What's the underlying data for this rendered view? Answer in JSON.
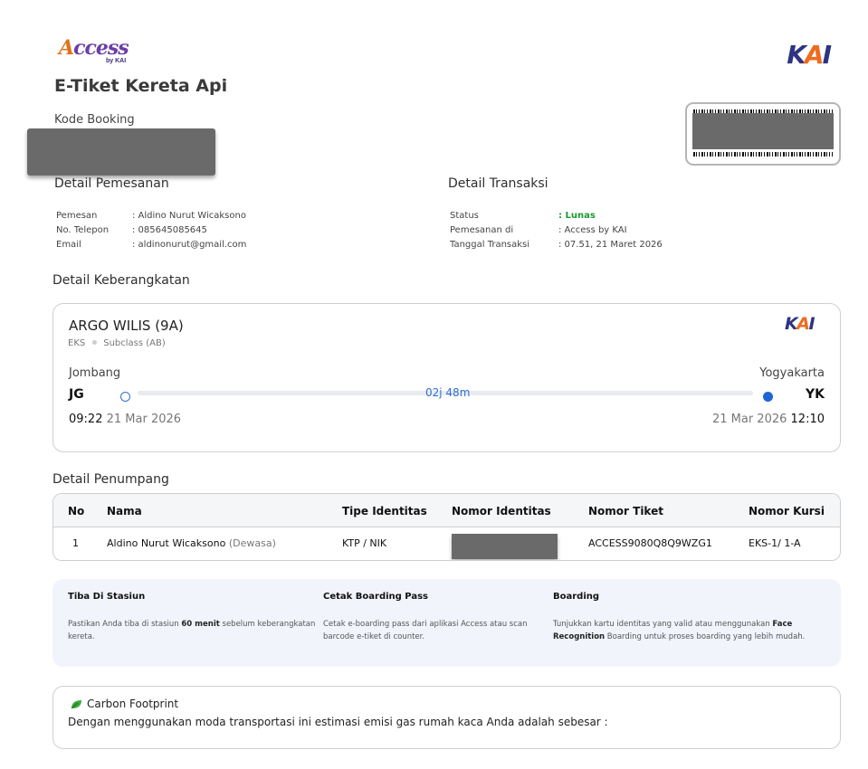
{
  "header": {
    "brand_main": "Access",
    "brand_sub": "by KAI",
    "kai_logo": "KAI",
    "title": "E-Tiket Kereta Api",
    "kode_booking_label": "Kode Booking"
  },
  "detail_pemesanan": {
    "title": "Detail Pemesanan",
    "rows": [
      {
        "label": "Pemesan",
        "value": ": Aldino Nurut Wicaksono"
      },
      {
        "label": "No. Telepon",
        "value": ": 085645085645"
      },
      {
        "label": "Email",
        "value": ": aldinonurut@gmail.com"
      }
    ]
  },
  "detail_transaksi": {
    "title": "Detail Transaksi",
    "rows": [
      {
        "label": "Status",
        "value": ": Lunas"
      },
      {
        "label": "Pemesanan di",
        "value": ": Access by KAI"
      },
      {
        "label": "Tanggal Transaksi",
        "value": ": 07.51, 21 Maret 2026"
      }
    ]
  },
  "keberangkatan": {
    "title": "Detail Keberangkatan",
    "train_name": "ARGO WILIS (9A)",
    "class": "EKS",
    "subclass": "Subclass (AB)",
    "origin_city": "Jombang",
    "origin_code": "JG",
    "dest_city": "Yogyakarta",
    "dest_code": "YK",
    "duration": "02j 48m",
    "depart_time": "09:22",
    "depart_date": "21 Mar 2026",
    "arrive_date": "21 Mar 2026",
    "arrive_time": "12:10"
  },
  "penumpang": {
    "title": "Detail Penumpang",
    "headers": [
      "No",
      "Nama",
      "Tipe Identitas",
      "Nomor Identitas",
      "Nomor Tiket",
      "Nomor Kursi"
    ],
    "rows": [
      {
        "no": "1",
        "nama": "Aldino Nurut Wicaksono",
        "kategori": "(Dewasa)",
        "tipe": "KTP / NIK",
        "tiket": "ACCESS9080Q8Q9WZG1",
        "kursi": "EKS-1/ 1-A"
      }
    ]
  },
  "tips": [
    {
      "title": "Tiba Di Stasiun",
      "body_a": "Pastikan Anda tiba di stasiun ",
      "body_bold": "60 menit",
      "body_b": " sebelum keberangkatan kereta."
    },
    {
      "title": "Cetak Boarding Pass",
      "body_a": "Cetak e-boarding pass dari aplikasi Access atau scan barcode e-tiket di counter.",
      "body_bold": "",
      "body_b": ""
    },
    {
      "title": "Boarding",
      "body_a": "Tunjukkan kartu identitas yang valid atau menggunakan ",
      "body_bold": "Face Recognition",
      "body_b": " Boarding untuk proses boarding yang lebih mudah."
    }
  ],
  "carbon": {
    "title": "Carbon Footprint",
    "text": "Dengan menggunakan moda transportasi ini estimasi emisi gas rumah kaca Anda adalah sebesar :"
  },
  "colors": {
    "status_green": "#1a9a2e",
    "accent_blue": "#2f6fd6",
    "kai_navy": "#2d3480",
    "kai_orange": "#ef6b1e"
  }
}
